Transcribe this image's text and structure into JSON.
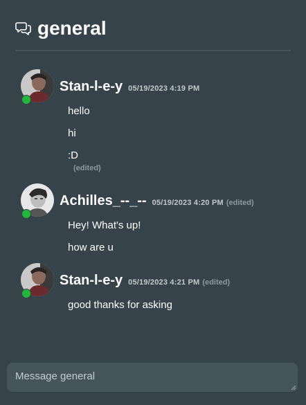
{
  "channel": {
    "name": "general",
    "icon": "chat-bubbles-icon"
  },
  "messages": [
    {
      "author": "Stan-l-e-y",
      "timestamp": "05/19/2023 4:19 PM",
      "online": true,
      "lines": [
        "hello",
        "hi",
        ":D"
      ],
      "edited_note": "(edited)"
    },
    {
      "author": "Achilles_--_--",
      "timestamp": "05/19/2023 4:20 PM",
      "online": true,
      "edited_note": "(edited)",
      "lines": [
        "Hey! What's up!",
        "how are u"
      ]
    },
    {
      "author": "Stan-l-e-y",
      "timestamp": "05/19/2023 4:21 PM",
      "online": true,
      "edited_note": "(edited)",
      "lines": [
        "good thanks for asking"
      ]
    }
  ],
  "composer": {
    "placeholder": "Message general"
  },
  "colors": {
    "background": "#36434b",
    "input_background": "#46545c",
    "online_status": "#1eb93a"
  }
}
